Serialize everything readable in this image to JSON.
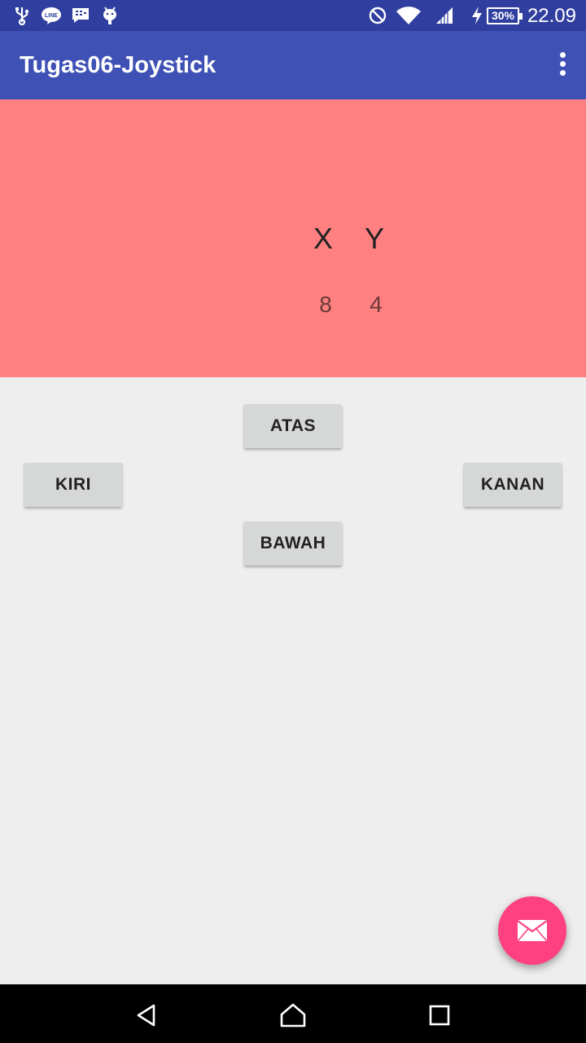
{
  "status_bar": {
    "time": "22.09",
    "battery": "30%",
    "icons": [
      "usb-icon",
      "line-app-icon",
      "bbm-icon",
      "android-debug-icon",
      "do-not-disturb-icon",
      "wifi-icon",
      "cell-signal-icon",
      "charging-icon",
      "battery-icon"
    ]
  },
  "app_bar": {
    "title": "Tugas06-Joystick",
    "menu_icon": "more-vert-icon"
  },
  "coords": {
    "x_label": "X",
    "y_label": "Y",
    "x_value": "8",
    "y_value": "4"
  },
  "controls": {
    "up": "ATAS",
    "left": "KIRI",
    "right": "KANAN",
    "down": "BAWAH"
  },
  "fab": {
    "icon": "mail-icon"
  },
  "nav_bar": {
    "icons": [
      "back-icon",
      "home-icon",
      "recents-icon"
    ]
  },
  "colors": {
    "status_bar": "#303F9F",
    "app_bar": "#3F51B5",
    "coord_panel": "#FF8080",
    "background": "#EEEEEE",
    "fab": "#FF4081",
    "button": "#D6D7D7"
  }
}
